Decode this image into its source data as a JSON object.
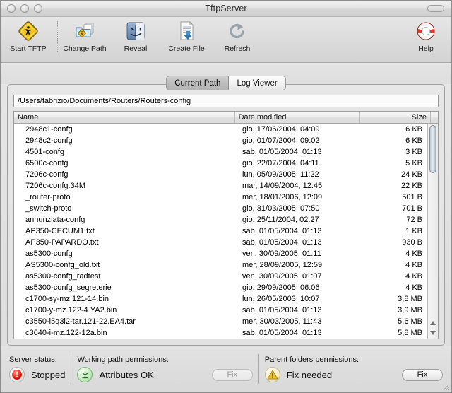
{
  "window": {
    "title": "TftpServer",
    "buttons": [
      "close",
      "minimize",
      "zoom"
    ]
  },
  "toolbar": {
    "items": [
      {
        "label": "Start TFTP",
        "icon": "caution-diamond-icon"
      },
      {
        "label": "Change Path",
        "icon": "folder-caution-icon"
      },
      {
        "label": "Reveal",
        "icon": "finder-face-icon"
      },
      {
        "label": "Create File",
        "icon": "new-document-icon"
      },
      {
        "label": "Refresh",
        "icon": "refresh-arrow-icon"
      }
    ],
    "help": {
      "label": "Help",
      "icon": "life-preserver-icon"
    }
  },
  "tabs": [
    {
      "label": "Current Path",
      "active": true
    },
    {
      "label": "Log Viewer",
      "active": false
    }
  ],
  "path": {
    "value": "/Users/fabrizio/Documents/Routers/Routers-config"
  },
  "filelist": {
    "columns": [
      "Name",
      "Date modified",
      "Size"
    ],
    "rows": [
      {
        "name": "2948c1-confg",
        "date": "gio, 17/06/2004, 04:09",
        "size": "6 KB"
      },
      {
        "name": "2948c2-confg",
        "date": "gio, 01/07/2004, 09:02",
        "size": "6 KB"
      },
      {
        "name": "4501-confg",
        "date": "sab, 01/05/2004, 01:13",
        "size": "3 KB"
      },
      {
        "name": "6500c-confg",
        "date": "gio, 22/07/2004, 04:11",
        "size": "5 KB"
      },
      {
        "name": "7206c-confg",
        "date": "lun, 05/09/2005, 11:22",
        "size": "24 KB"
      },
      {
        "name": "7206c-confg.34M",
        "date": "mar, 14/09/2004, 12:45",
        "size": "22 KB"
      },
      {
        "name": "_router-proto",
        "date": "mer, 18/01/2006, 12:09",
        "size": "501 B"
      },
      {
        "name": "_switch-proto",
        "date": "gio, 31/03/2005, 07:50",
        "size": "701 B"
      },
      {
        "name": "annunziata-confg",
        "date": "gio, 25/11/2004, 02:27",
        "size": "72 B"
      },
      {
        "name": "AP350-CECUM1.txt",
        "date": "sab, 01/05/2004, 01:13",
        "size": "1 KB"
      },
      {
        "name": "AP350-PAPARDO.txt",
        "date": "sab, 01/05/2004, 01:13",
        "size": "930 B"
      },
      {
        "name": "as5300-confg",
        "date": "ven, 30/09/2005, 01:11",
        "size": "4 KB"
      },
      {
        "name": "AS5300-confg_old.txt",
        "date": "mer, 28/09/2005, 12:59",
        "size": "4 KB"
      },
      {
        "name": "as5300-confg_radtest",
        "date": "ven, 30/09/2005, 01:07",
        "size": "4 KB"
      },
      {
        "name": "as5300-confg_segreterie",
        "date": "gio, 29/09/2005, 06:06",
        "size": "4 KB"
      },
      {
        "name": "c1700-sy-mz.121-14.bin",
        "date": "lun, 26/05/2003, 10:07",
        "size": "3,8 MB"
      },
      {
        "name": "c1700-y-mz.122-4.YA2.bin",
        "date": "sab, 01/05/2004, 01:13",
        "size": "3,9 MB"
      },
      {
        "name": "c3550-i5q3l2-tar.121-22.EA4.tar",
        "date": "mer, 30/03/2005, 11:43",
        "size": "5,6 MB"
      },
      {
        "name": "c3640-i-mz.122-12a.bin",
        "date": "sab, 01/05/2004, 01:13",
        "size": "5,8 MB"
      }
    ]
  },
  "status": {
    "server": {
      "title": "Server status:",
      "value": "Stopped",
      "icon": "red-stop-led-icon"
    },
    "working_path": {
      "title": "Working path permissions:",
      "value": "Attributes OK",
      "icon": "green-ok-led-icon",
      "fix_label": "Fix",
      "fix_disabled": true
    },
    "parent_folders": {
      "title": "Parent folders permissions:",
      "value": "Fix needed",
      "icon": "yellow-warning-icon",
      "fix_label": "Fix",
      "fix_disabled": false
    }
  },
  "colors": {
    "accent_red": "#e02212",
    "accent_green": "#8ccf88",
    "accent_yellow": "#f5c518"
  }
}
